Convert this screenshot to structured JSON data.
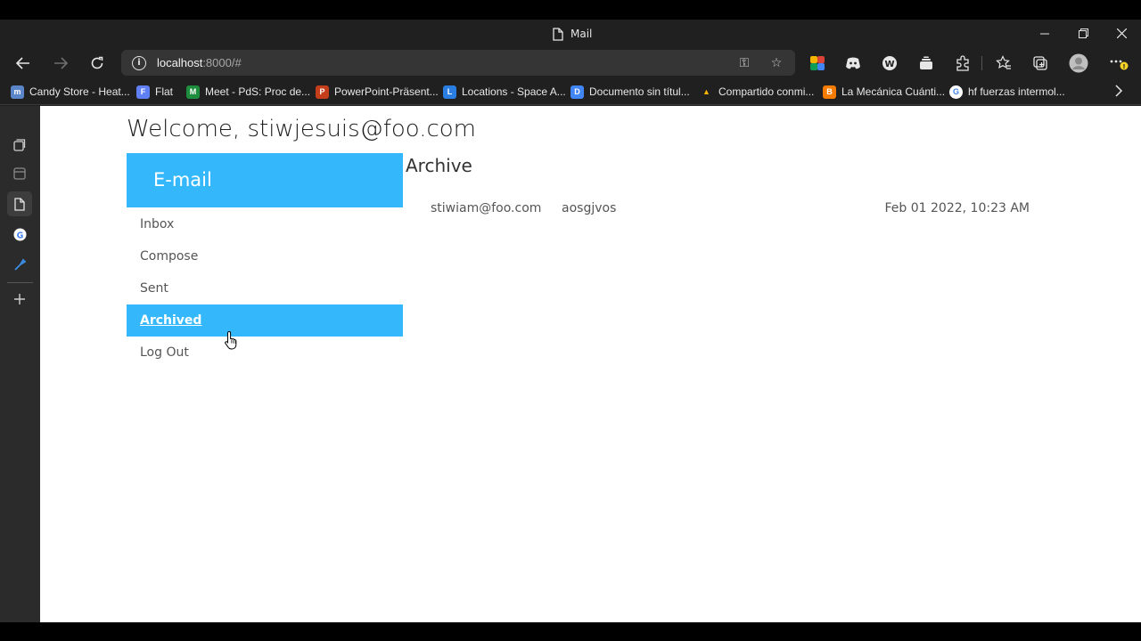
{
  "browser": {
    "tab_title": "Mail",
    "url_host": "localhost",
    "url_rest": ":8000/#",
    "bookmarks": [
      {
        "label": "Candy Store - Heat...",
        "color": "#5a86c9",
        "glyph": "m"
      },
      {
        "label": "Flat",
        "color": "#5f7ff5",
        "glyph": "F"
      },
      {
        "label": "Meet - PdS: Proc de...",
        "color": "#1e8e3e",
        "glyph": "M"
      },
      {
        "label": "PowerPoint-Präsent...",
        "color": "#c43e1c",
        "glyph": "P"
      },
      {
        "label": "Locations - Space A...",
        "color": "#2a7de1",
        "glyph": "L"
      },
      {
        "label": "Documento sin títul...",
        "color": "#4285f4",
        "glyph": "D"
      },
      {
        "label": "Compartido conmi...",
        "color": "#f4b400",
        "glyph": "▲"
      },
      {
        "label": "La Mecánica Cuánti...",
        "color": "#f57c00",
        "glyph": "B"
      },
      {
        "label": "hf fuerzas intermol...",
        "color": "#ffffff",
        "glyph": "G"
      }
    ]
  },
  "app": {
    "welcome": "Welcome, stiwjesuis@foo.com",
    "brand": "E-mail",
    "menu": [
      {
        "label": "Inbox",
        "active": false
      },
      {
        "label": "Compose",
        "active": false
      },
      {
        "label": "Sent",
        "active": false
      },
      {
        "label": "Archived",
        "active": true
      },
      {
        "label": "Log Out",
        "active": false
      }
    ],
    "view_title": "Archive",
    "emails": [
      {
        "sender": "stiwiam@foo.com",
        "subject": "aosgjvos",
        "timestamp": "Feb 01 2022, 10:23 AM"
      }
    ]
  }
}
